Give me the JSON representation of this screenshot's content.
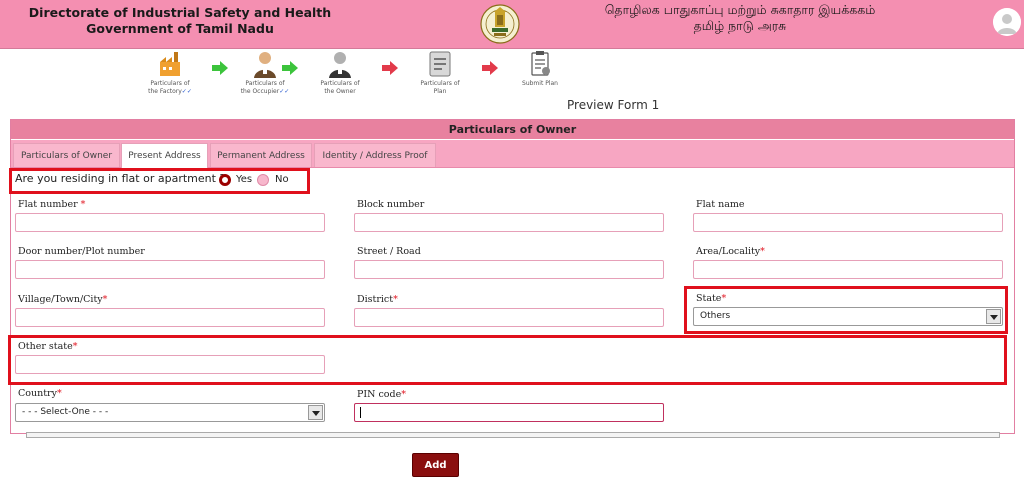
{
  "header": {
    "title_en_line1": "Directorate of Industrial Safety and Health",
    "title_en_line2": "Government of Tamil Nadu",
    "title_ta_line1": "தொழிலக பாதுகாப்பு மற்றும் சுகாதார இயக்ககம்",
    "title_ta_line2": "தமிழ் நாடு அரசு"
  },
  "steps": [
    {
      "label_1": "Particulars of",
      "label_2": "the Factory",
      "done": "✓✓"
    },
    {
      "label_1": "Particulars of",
      "label_2": "the Occupier",
      "done": "✓✓"
    },
    {
      "label_1": "Particulars of",
      "label_2": "the Owner",
      "done": ""
    },
    {
      "label_1": "Particulars of",
      "label_2": "Plan",
      "done": ""
    },
    {
      "label_1": "Submit Plan",
      "label_2": "",
      "done": ""
    }
  ],
  "preview_label": "Preview Form 1",
  "panel_title": "Particulars of Owner",
  "tabs": [
    "Particulars of Owner",
    "Present Address",
    "Permanent Address",
    "Identity / Address Proof"
  ],
  "active_tab": "Present Address",
  "question": {
    "text": "Are you residing in flat or apartment ?",
    "yes": "Yes",
    "no": "No",
    "selected": "Yes"
  },
  "fields": {
    "flat_number": {
      "label": "Flat number",
      "required": "*",
      "value": ""
    },
    "block_number": {
      "label": "Block number",
      "value": ""
    },
    "flat_name": {
      "label": "Flat name",
      "value": ""
    },
    "door_number": {
      "label": "Door number/Plot number",
      "value": ""
    },
    "street": {
      "label": "Street / Road",
      "value": ""
    },
    "area": {
      "label": "Area/Locality",
      "required": "*",
      "value": ""
    },
    "village": {
      "label": "Village/Town/City",
      "required": "*",
      "value": ""
    },
    "district": {
      "label": "District",
      "required": "*",
      "value": ""
    },
    "state": {
      "label": "State",
      "required": "*",
      "value": "Others"
    },
    "other_state": {
      "label": "Other state",
      "required": "*",
      "value": ""
    },
    "country": {
      "label": "Country",
      "required": "*",
      "value": "- - - Select-One - - -"
    },
    "pin_code": {
      "label": "PIN code",
      "required": "*",
      "value": ""
    }
  },
  "add_button": "Add",
  "colors": {
    "header_bg": "#f48fb1",
    "panel_head_bg": "#e8819f",
    "highlight_box": "#e0101c",
    "add_button_bg": "#8a0f0f"
  }
}
